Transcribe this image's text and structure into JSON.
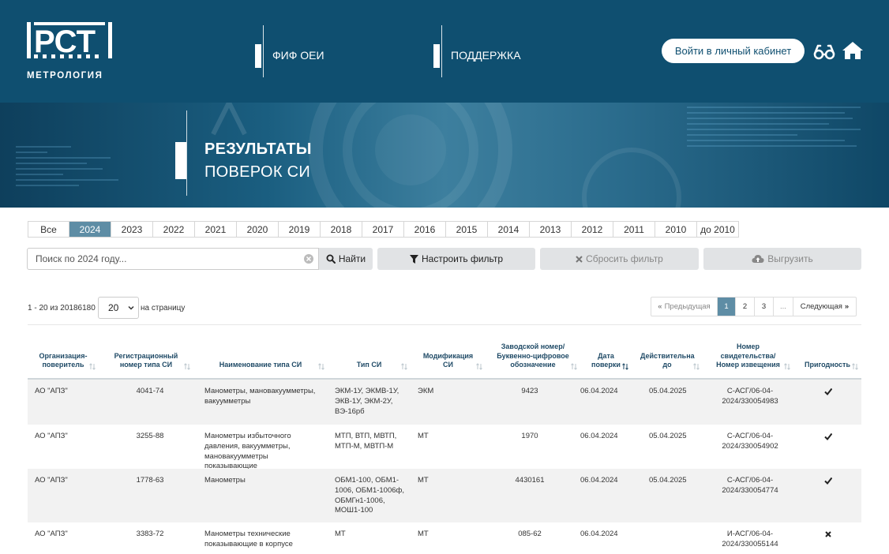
{
  "header": {
    "logo_text": "МЕТРОЛОГИЯ",
    "nav": [
      {
        "label": "ФИФ ОЕИ"
      },
      {
        "label": "ПОДДЕРЖКА"
      }
    ],
    "login_label": "Войти в личный кабинет",
    "icons": [
      "glasses-icon",
      "home-icon"
    ],
    "brand_color": "#0f4f70"
  },
  "banner": {
    "title_line1": "РЕЗУЛЬТАТЫ",
    "title_line2": "ПОВЕРОК СИ"
  },
  "years": [
    "Все",
    "2024",
    "2023",
    "2022",
    "2021",
    "2020",
    "2019",
    "2018",
    "2017",
    "2016",
    "2015",
    "2014",
    "2013",
    "2012",
    "2011",
    "2010",
    "до 2010"
  ],
  "active_year": "2024",
  "search": {
    "placeholder": "Поиск по 2024 году...",
    "value": "",
    "button_label": "Найти"
  },
  "toolbar": {
    "filter_label": "Настроить фильтр",
    "reset_label": "Сбросить фильтр",
    "export_label": "Выгрузить"
  },
  "paging": {
    "count_text": "1 - 20 из 20186180",
    "per_page": "20",
    "per_page_label": "на страницу",
    "prev_label": "Предыдущая",
    "pages": [
      "1",
      "2",
      "3",
      "..."
    ],
    "active_page": "1",
    "next_label": "Следующая"
  },
  "table": {
    "headers": [
      "Организация-поверитель",
      "Регистрационный номер типа СИ",
      "Наименование типа СИ",
      "Тип СИ",
      "Модификация СИ",
      "Заводской номер/ Буквенно-цифровое обозначение",
      "Дата поверки",
      "Действительна до",
      "Номер свидетельства/ Номер извещения",
      "Пригодность"
    ],
    "rows": [
      {
        "org": "АО \"АПЗ\"",
        "reg": "4041-74",
        "name": "Манометры, мановакуумметры, вакуумметры",
        "type": "ЭКМ-1У, ЭКМВ-1У, ЭКВ-1У, ЭКМ-2У, ВЭ-16рб",
        "mod": "ЭКМ",
        "serial": "9423",
        "date": "06.04.2024",
        "valid": "05.04.2025",
        "cert": "С-АСГ/06-04-2024/330054983",
        "fit": "check"
      },
      {
        "org": "АО \"АПЗ\"",
        "reg": "3255-88",
        "name": "Манометры избыточного давления, вакуумметры, мановакуумметры показывающие",
        "type": "МТП, ВТП, МВТП, МТП-М, МВТП-М",
        "mod": "МТ",
        "serial": "1970",
        "date": "06.04.2024",
        "valid": "05.04.2025",
        "cert": "С-АСГ/06-04-2024/330054902",
        "fit": "check"
      },
      {
        "org": "АО \"АПЗ\"",
        "reg": "1778-63",
        "name": "Манометры",
        "type": "ОБМ1-100, ОБМ1-1006, ОБМ1-1006ф, ОБМГн1-1006, МОШ1-100",
        "mod": "МТ",
        "serial": "4430161",
        "date": "06.04.2024",
        "valid": "05.04.2025",
        "cert": "С-АСГ/06-04-2024/330054774",
        "fit": "check"
      },
      {
        "org": "АО \"АПЗ\"",
        "reg": "3383-72",
        "name": "Манометры технические показывающие в корпусе",
        "type": "МТ",
        "mod": "МТ",
        "serial": "085-62",
        "date": "06.04.2024",
        "valid": "",
        "cert": "И-АСГ/06-04-2024/330055144",
        "fit": "cross"
      }
    ]
  }
}
